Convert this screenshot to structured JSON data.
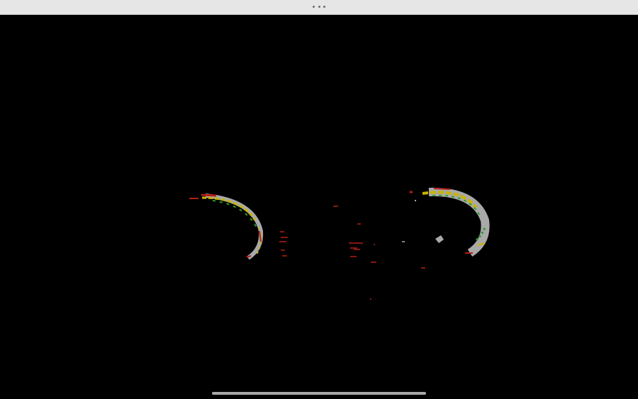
{
  "window": {
    "background_color": "#000000",
    "title_bar_color": "#e6e6e6"
  },
  "title_bar": {
    "more_icon": "ellipsis-icon"
  },
  "canvas": {
    "content": "scan-visualization",
    "colors": {
      "gray": "#a9a9a9",
      "yellow": "#c8b400",
      "green": "#2f9a2f",
      "red": "#b41e14"
    }
  },
  "home_indicator": {
    "color": "#a8a8a8"
  }
}
